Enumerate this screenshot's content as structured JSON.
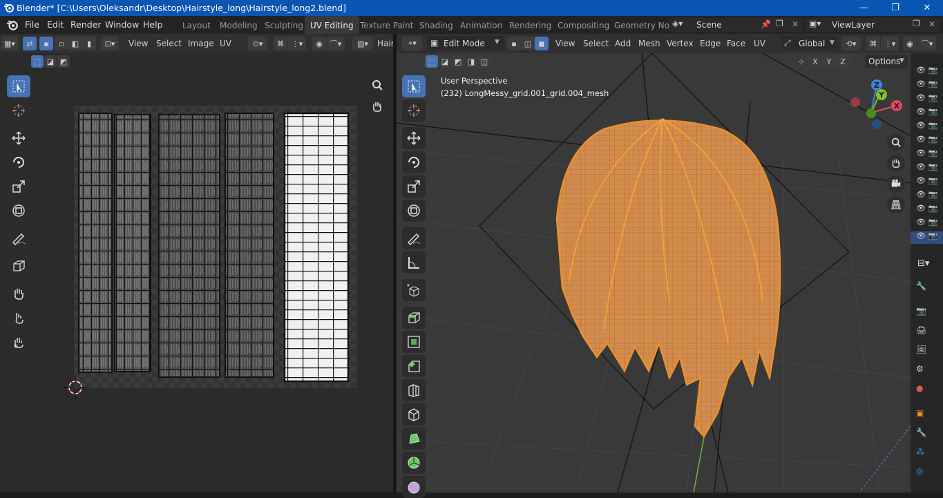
{
  "window": {
    "title": "Blender* [C:\\Users\\Oleksandr\\Desktop\\Hairstyle_long\\Hairstyle_long2.blend]",
    "minimize": "—",
    "maximize": "❐",
    "close": "✕"
  },
  "menu": [
    "File",
    "Edit",
    "Render",
    "Window",
    "Help"
  ],
  "workspaces": [
    "Layout",
    "Modeling",
    "Sculpting",
    "UV Editing",
    "Texture Paint",
    "Shading",
    "Animation",
    "Rendering",
    "Compositing",
    "Geometry Noc"
  ],
  "active_workspace": "UV Editing",
  "scene": {
    "name": "Scene",
    "view_layer": "ViewLayer"
  },
  "uv_editor": {
    "menus": [
      "View",
      "Select",
      "Image",
      "UV"
    ],
    "image_name": "Hair"
  },
  "viewport3d": {
    "mode": "Edit Mode",
    "menus": [
      "View",
      "Select",
      "Add",
      "Mesh",
      "Vertex",
      "Edge",
      "Face",
      "UV"
    ],
    "transform_orientation": "Global",
    "axes": [
      "X",
      "Y",
      "Z"
    ],
    "options_label": "Options",
    "view_name": "User Perspective",
    "object_info": "(232) LongMessy_grid.001_grid.004_mesh",
    "gizmo_labels": [
      "Z",
      "Y",
      "X"
    ]
  },
  "colors": {
    "accent": "#4772b3",
    "title_bar": "#0a56b2",
    "hair_orange": "#e8912f",
    "axis_x": "#e34a5e",
    "axis_y": "#7ec42c",
    "axis_z": "#3d85dd"
  },
  "icons": {
    "blender_logo": "blender-logo-icon",
    "cursor": "cursor-icon",
    "move": "move-icon",
    "rotate": "rotate-icon",
    "scale": "scale-icon",
    "transform": "transform-icon",
    "annotate": "annotate-icon",
    "measure": "measure-icon",
    "zoom": "zoom-icon",
    "hand": "hand-icon",
    "camera": "camera-icon",
    "grid": "grid-icon"
  }
}
